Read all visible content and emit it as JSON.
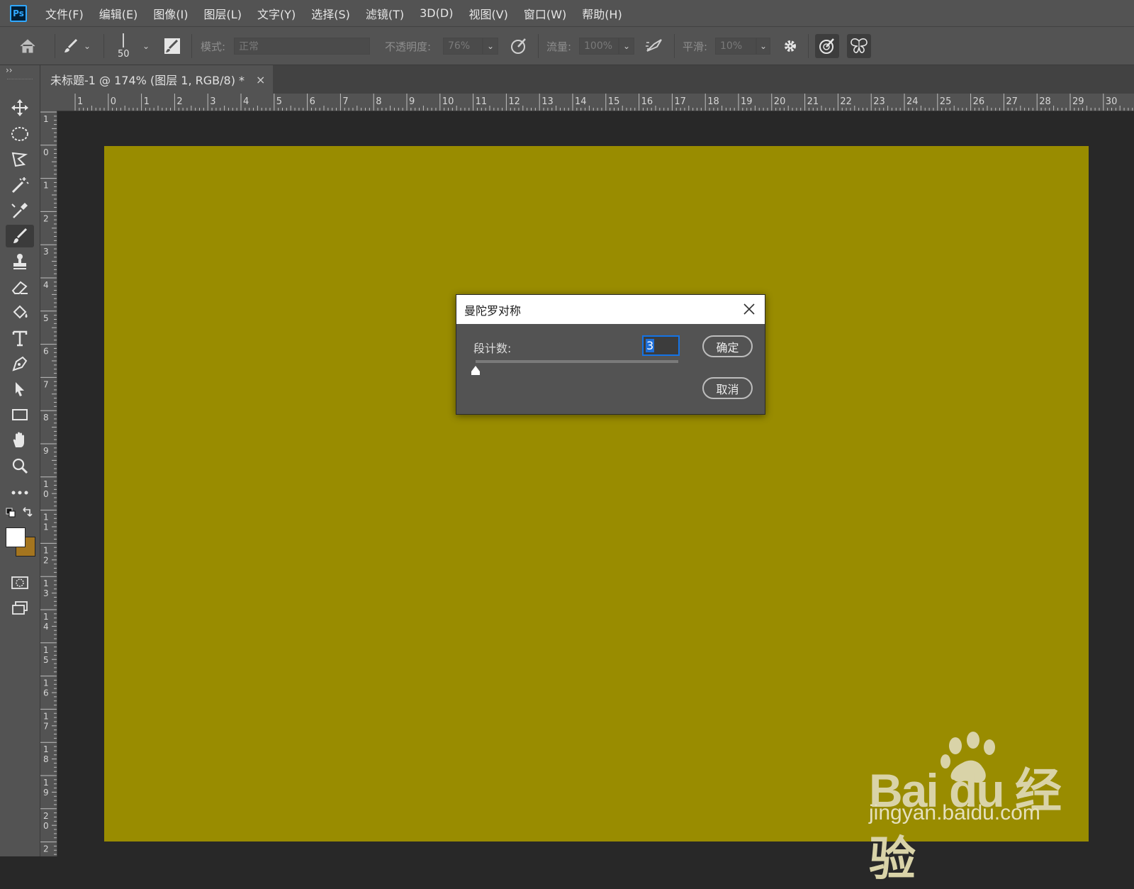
{
  "app": {
    "logo_text": "Ps"
  },
  "menu": [
    "文件(F)",
    "编辑(E)",
    "图像(I)",
    "图层(L)",
    "文字(Y)",
    "选择(S)",
    "滤镜(T)",
    "3D(D)",
    "视图(V)",
    "窗口(W)",
    "帮助(H)"
  ],
  "options": {
    "brush_size": "50",
    "mode_label": "模式:",
    "mode_value": "正常",
    "opacity_label": "不透明度:",
    "opacity_value": "76%",
    "flow_label": "流量:",
    "flow_value": "100%",
    "smoothing_label": "平滑:",
    "smoothing_value": "10%"
  },
  "panel_collapse": "››",
  "document_tab": {
    "title": "未标题-1 @ 174% (图层 1, RGB/8) *",
    "close": "×"
  },
  "ruler": {
    "h_labels": [
      "1",
      "0",
      "1",
      "2",
      "3",
      "4",
      "5",
      "6",
      "7",
      "8",
      "9",
      "10",
      "11",
      "12",
      "13",
      "14",
      "15",
      "16",
      "17",
      "18",
      "19",
      "20",
      "21",
      "22",
      "23",
      "24",
      "25",
      "26",
      "27",
      "28",
      "29",
      "30"
    ],
    "v_labels": [
      "1",
      "0",
      "1",
      "2",
      "3",
      "4",
      "5",
      "6",
      "7",
      "8",
      "9",
      "10",
      "11",
      "12",
      "13",
      "14",
      "15",
      "16",
      "17",
      "18",
      "19",
      "20",
      "2"
    ]
  },
  "colors": {
    "canvas": "#998c00",
    "foreground": "#ffffff",
    "background": "#a4751f",
    "accent": "#1473e6"
  },
  "dialog": {
    "title": "曼陀罗对称",
    "segment_label": "段计数:",
    "segment_value": "3",
    "slider_value": 3,
    "ok": "确定",
    "cancel": "取消"
  },
  "watermark": {
    "brand": "Bai du 经验",
    "url": "jingyan.baidu.com"
  }
}
